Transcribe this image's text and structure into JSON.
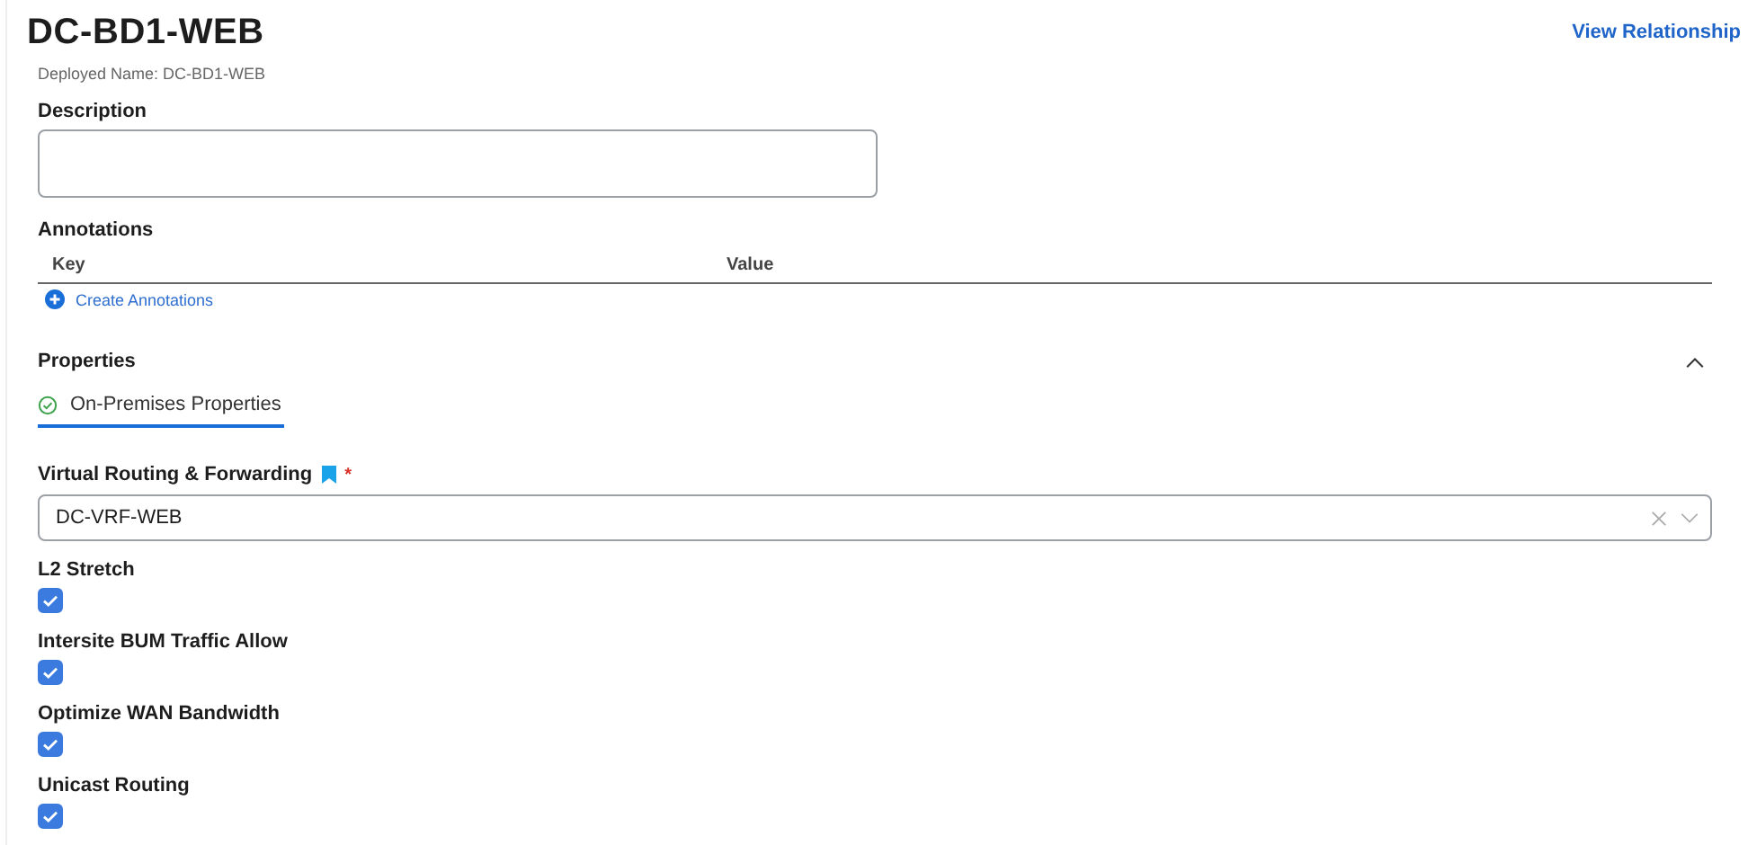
{
  "header": {
    "title": "DC-BD1-WEB",
    "link": "View Relationship",
    "deployed_name": "Deployed Name: DC-BD1-WEB"
  },
  "description": {
    "label": "Description"
  },
  "annotations": {
    "label": "Annotations",
    "columns": [
      "Key",
      "Value"
    ],
    "create_link": "Create Annotations"
  },
  "properties": {
    "label": "Properties",
    "expanded": true,
    "tabs": [
      {
        "label": "On-Premises Properties",
        "selected": true
      }
    ]
  },
  "vrf": {
    "label": "Virtual Routing & Forwarding",
    "required_mark": "*",
    "value": "DC-VRF-WEB"
  },
  "options": [
    {
      "label": "L2 Stretch",
      "checked": true
    },
    {
      "label": "Intersite BUM Traffic Allow",
      "checked": true
    },
    {
      "label": "Optimize WAN Bandwidth",
      "checked": true
    },
    {
      "label": "Unicast Routing",
      "checked": true
    }
  ]
}
